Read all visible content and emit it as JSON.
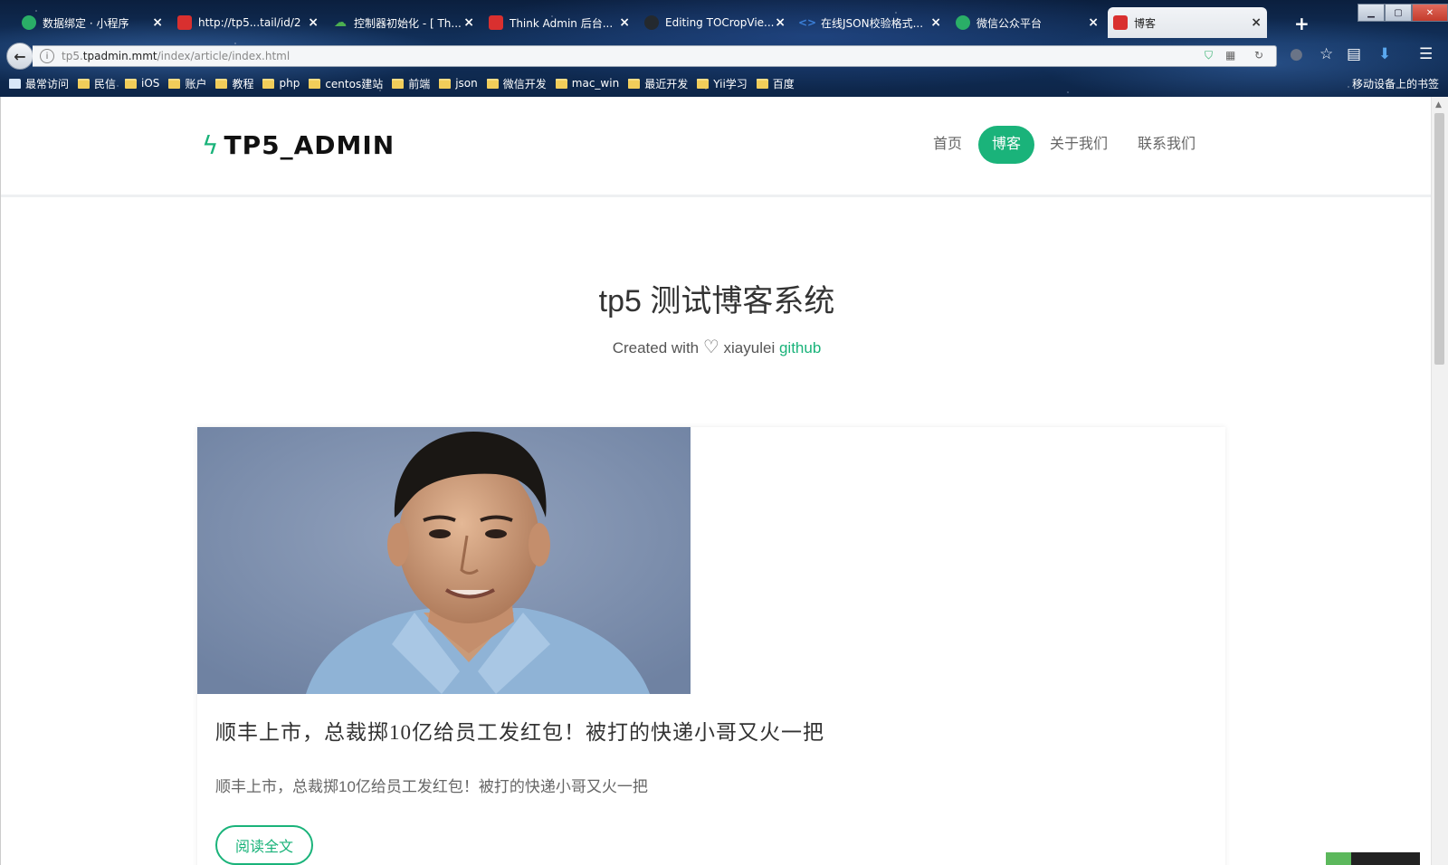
{
  "browser": {
    "tabs": [
      {
        "title": "数据绑定 · 小程序",
        "favicon": "wechat-icon",
        "color": "#2aae67"
      },
      {
        "title": "http://tp5...tail/id/2",
        "favicon": "tp-icon",
        "color": "#d9302f"
      },
      {
        "title": "控制器初始化 - [ Th...",
        "favicon": "thinkphp-icon",
        "color": "#4caf50"
      },
      {
        "title": "Think Admin 后台...",
        "favicon": "tp-icon",
        "color": "#d9302f"
      },
      {
        "title": "Editing TOCropVie...",
        "favicon": "github-icon",
        "color": "#24292e"
      },
      {
        "title": "在线JSON校验格式...",
        "favicon": "code-icon",
        "color": "#3b7fd8"
      },
      {
        "title": "微信公众平台",
        "favicon": "wechat-icon",
        "color": "#2aae67"
      },
      {
        "title": "博客",
        "favicon": "tp-icon",
        "color": "#d9302f",
        "active": true
      }
    ],
    "address": {
      "prefix": "tp5.",
      "host": "tpadmin.mmt",
      "path": "/index/article/index.html"
    },
    "bookmarks": [
      "最常访问",
      "民信",
      "iOS",
      "账户",
      "教程",
      "php",
      "centos建站",
      "前端",
      "json",
      "微信开发",
      "mac_win",
      "最近开发",
      "Yii学习",
      "百度"
    ],
    "mobile_bookmarks": "移动设备上的书签"
  },
  "site": {
    "logo": "TP5_ADMIN",
    "nav": [
      "首页",
      "博客",
      "关于我们",
      "联系我们"
    ],
    "nav_active": 1,
    "accent": "#1ab37a"
  },
  "hero": {
    "title": "tp5 测试博客系统",
    "created_with": "Created with",
    "author": "xiayulei",
    "link": "github"
  },
  "article": {
    "title": "顺丰上市，总裁掷10亿给员工发红包！被打的快递小哥又火一把",
    "summary": "顺丰上市，总裁掷10亿给员工发红包！被打的快递小哥又火一把",
    "read_more": "阅读全文"
  }
}
